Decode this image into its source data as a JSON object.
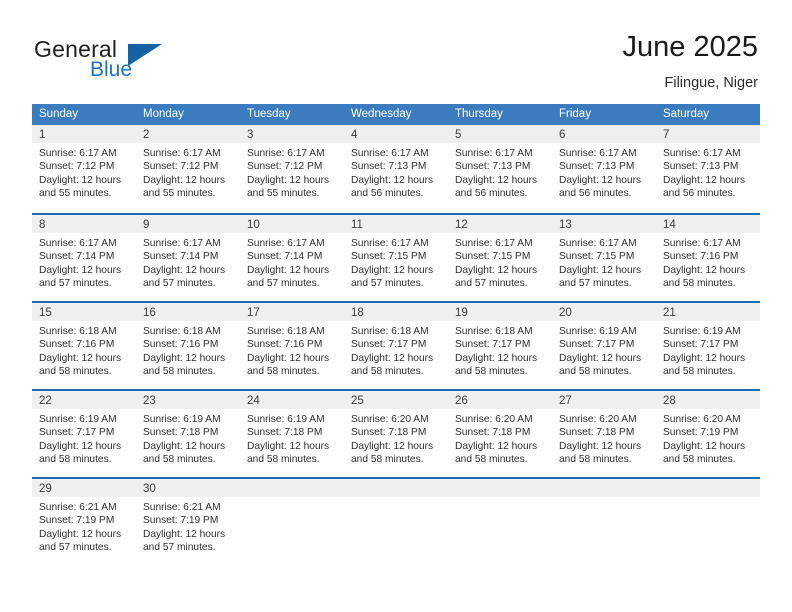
{
  "brand": {
    "word_general": "General",
    "word_blue": "Blue"
  },
  "header": {
    "title": "June 2025",
    "subtitle": "Filingue, Niger"
  },
  "colors": {
    "header_blue": "#3a7cbe",
    "row_divider_blue": "#1f6cb0",
    "day_band_gray": "#efefef",
    "brand_blue": "#1d72bb",
    "logo_triangle": "#1464a5"
  },
  "weekdays": [
    "Sunday",
    "Monday",
    "Tuesday",
    "Wednesday",
    "Thursday",
    "Friday",
    "Saturday"
  ],
  "weeks": [
    [
      {
        "day": "1",
        "lines": [
          "Sunrise: 6:17 AM",
          "Sunset: 7:12 PM",
          "Daylight: 12 hours",
          "and 55 minutes."
        ]
      },
      {
        "day": "2",
        "lines": [
          "Sunrise: 6:17 AM",
          "Sunset: 7:12 PM",
          "Daylight: 12 hours",
          "and 55 minutes."
        ]
      },
      {
        "day": "3",
        "lines": [
          "Sunrise: 6:17 AM",
          "Sunset: 7:12 PM",
          "Daylight: 12 hours",
          "and 55 minutes."
        ]
      },
      {
        "day": "4",
        "lines": [
          "Sunrise: 6:17 AM",
          "Sunset: 7:13 PM",
          "Daylight: 12 hours",
          "and 56 minutes."
        ]
      },
      {
        "day": "5",
        "lines": [
          "Sunrise: 6:17 AM",
          "Sunset: 7:13 PM",
          "Daylight: 12 hours",
          "and 56 minutes."
        ]
      },
      {
        "day": "6",
        "lines": [
          "Sunrise: 6:17 AM",
          "Sunset: 7:13 PM",
          "Daylight: 12 hours",
          "and 56 minutes."
        ]
      },
      {
        "day": "7",
        "lines": [
          "Sunrise: 6:17 AM",
          "Sunset: 7:13 PM",
          "Daylight: 12 hours",
          "and 56 minutes."
        ]
      }
    ],
    [
      {
        "day": "8",
        "lines": [
          "Sunrise: 6:17 AM",
          "Sunset: 7:14 PM",
          "Daylight: 12 hours",
          "and 57 minutes."
        ]
      },
      {
        "day": "9",
        "lines": [
          "Sunrise: 6:17 AM",
          "Sunset: 7:14 PM",
          "Daylight: 12 hours",
          "and 57 minutes."
        ]
      },
      {
        "day": "10",
        "lines": [
          "Sunrise: 6:17 AM",
          "Sunset: 7:14 PM",
          "Daylight: 12 hours",
          "and 57 minutes."
        ]
      },
      {
        "day": "11",
        "lines": [
          "Sunrise: 6:17 AM",
          "Sunset: 7:15 PM",
          "Daylight: 12 hours",
          "and 57 minutes."
        ]
      },
      {
        "day": "12",
        "lines": [
          "Sunrise: 6:17 AM",
          "Sunset: 7:15 PM",
          "Daylight: 12 hours",
          "and 57 minutes."
        ]
      },
      {
        "day": "13",
        "lines": [
          "Sunrise: 6:17 AM",
          "Sunset: 7:15 PM",
          "Daylight: 12 hours",
          "and 57 minutes."
        ]
      },
      {
        "day": "14",
        "lines": [
          "Sunrise: 6:17 AM",
          "Sunset: 7:16 PM",
          "Daylight: 12 hours",
          "and 58 minutes."
        ]
      }
    ],
    [
      {
        "day": "15",
        "lines": [
          "Sunrise: 6:18 AM",
          "Sunset: 7:16 PM",
          "Daylight: 12 hours",
          "and 58 minutes."
        ]
      },
      {
        "day": "16",
        "lines": [
          "Sunrise: 6:18 AM",
          "Sunset: 7:16 PM",
          "Daylight: 12 hours",
          "and 58 minutes."
        ]
      },
      {
        "day": "17",
        "lines": [
          "Sunrise: 6:18 AM",
          "Sunset: 7:16 PM",
          "Daylight: 12 hours",
          "and 58 minutes."
        ]
      },
      {
        "day": "18",
        "lines": [
          "Sunrise: 6:18 AM",
          "Sunset: 7:17 PM",
          "Daylight: 12 hours",
          "and 58 minutes."
        ]
      },
      {
        "day": "19",
        "lines": [
          "Sunrise: 6:18 AM",
          "Sunset: 7:17 PM",
          "Daylight: 12 hours",
          "and 58 minutes."
        ]
      },
      {
        "day": "20",
        "lines": [
          "Sunrise: 6:19 AM",
          "Sunset: 7:17 PM",
          "Daylight: 12 hours",
          "and 58 minutes."
        ]
      },
      {
        "day": "21",
        "lines": [
          "Sunrise: 6:19 AM",
          "Sunset: 7:17 PM",
          "Daylight: 12 hours",
          "and 58 minutes."
        ]
      }
    ],
    [
      {
        "day": "22",
        "lines": [
          "Sunrise: 6:19 AM",
          "Sunset: 7:17 PM",
          "Daylight: 12 hours",
          "and 58 minutes."
        ]
      },
      {
        "day": "23",
        "lines": [
          "Sunrise: 6:19 AM",
          "Sunset: 7:18 PM",
          "Daylight: 12 hours",
          "and 58 minutes."
        ]
      },
      {
        "day": "24",
        "lines": [
          "Sunrise: 6:19 AM",
          "Sunset: 7:18 PM",
          "Daylight: 12 hours",
          "and 58 minutes."
        ]
      },
      {
        "day": "25",
        "lines": [
          "Sunrise: 6:20 AM",
          "Sunset: 7:18 PM",
          "Daylight: 12 hours",
          "and 58 minutes."
        ]
      },
      {
        "day": "26",
        "lines": [
          "Sunrise: 6:20 AM",
          "Sunset: 7:18 PM",
          "Daylight: 12 hours",
          "and 58 minutes."
        ]
      },
      {
        "day": "27",
        "lines": [
          "Sunrise: 6:20 AM",
          "Sunset: 7:18 PM",
          "Daylight: 12 hours",
          "and 58 minutes."
        ]
      },
      {
        "day": "28",
        "lines": [
          "Sunrise: 6:20 AM",
          "Sunset: 7:19 PM",
          "Daylight: 12 hours",
          "and 58 minutes."
        ]
      }
    ],
    [
      {
        "day": "29",
        "lines": [
          "Sunrise: 6:21 AM",
          "Sunset: 7:19 PM",
          "Daylight: 12 hours",
          "and 57 minutes."
        ]
      },
      {
        "day": "30",
        "lines": [
          "Sunrise: 6:21 AM",
          "Sunset: 7:19 PM",
          "Daylight: 12 hours",
          "and 57 minutes."
        ]
      },
      {
        "day": "",
        "lines": []
      },
      {
        "day": "",
        "lines": []
      },
      {
        "day": "",
        "lines": []
      },
      {
        "day": "",
        "lines": []
      },
      {
        "day": "",
        "lines": []
      }
    ]
  ]
}
